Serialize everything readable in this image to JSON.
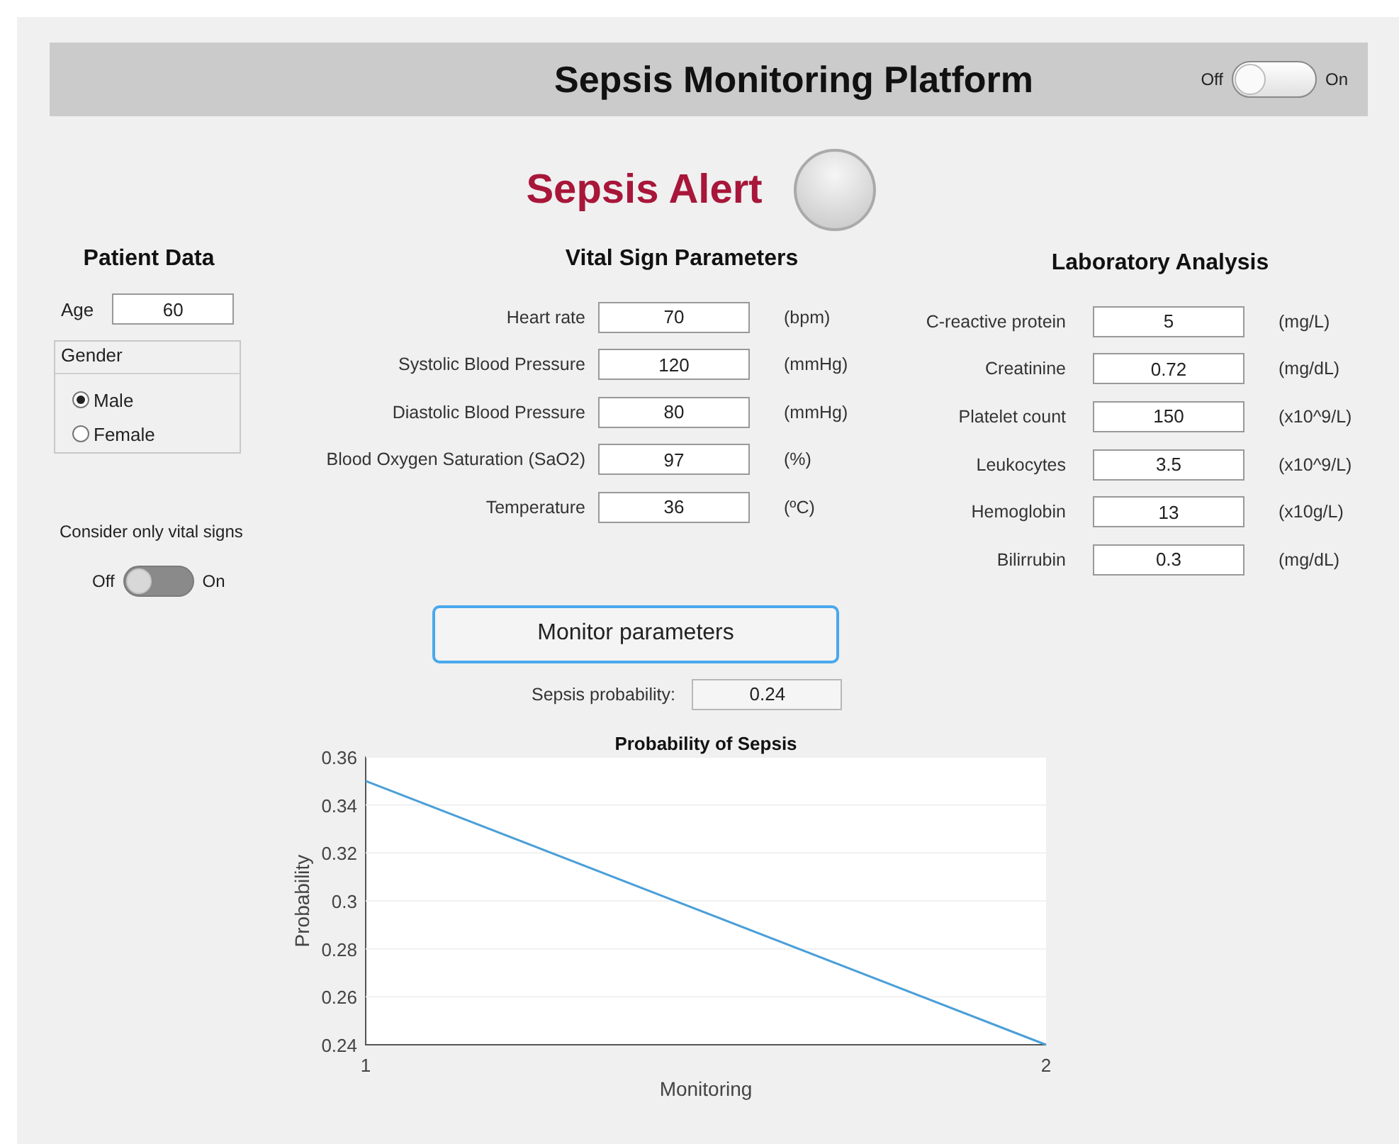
{
  "header": {
    "title": "Sepsis Monitoring Platform",
    "switch": {
      "off_label": "Off",
      "on_label": "On",
      "on": false
    }
  },
  "alert": {
    "label": "Sepsis Alert",
    "lit": false
  },
  "patient_data": {
    "title": "Patient Data",
    "age": {
      "label": "Age",
      "value": "60"
    },
    "gender": {
      "title": "Gender",
      "options": [
        {
          "label": "Male",
          "selected": true
        },
        {
          "label": "Female",
          "selected": false
        }
      ]
    },
    "vital_only": {
      "label": "Consider only vital signs",
      "off_label": "Off",
      "on_label": "On",
      "on": false
    }
  },
  "vital_signs": {
    "title": "Vital Sign Parameters",
    "rows": [
      {
        "label": "Heart rate",
        "value": "70",
        "unit": "(bpm)"
      },
      {
        "label": "Systolic Blood Pressure",
        "value": "120",
        "unit": "(mmHg)"
      },
      {
        "label": "Diastolic Blood Pressure",
        "value": "80",
        "unit": "(mmHg)"
      },
      {
        "label": "Blood Oxygen Saturation (SaO2)",
        "value": "97",
        "unit": "(%)"
      },
      {
        "label": "Temperature",
        "value": "36",
        "unit": "(ºC)"
      }
    ]
  },
  "laboratory": {
    "title": "Laboratory Analysis",
    "rows": [
      {
        "label": "C-reactive protein",
        "value": "5",
        "unit": "(mg/L)"
      },
      {
        "label": "Creatinine",
        "value": "0.72",
        "unit": "(mg/dL)"
      },
      {
        "label": "Platelet count",
        "value": "150",
        "unit": "(x10^9/L)"
      },
      {
        "label": "Leukocytes",
        "value": "3.5",
        "unit": "(x10^9/L)"
      },
      {
        "label": "Hemoglobin",
        "value": "13",
        "unit": "(x10g/L)"
      },
      {
        "label": "Bilirrubin",
        "value": "0.3",
        "unit": "(mg/dL)"
      }
    ]
  },
  "monitor_button": "Monitor parameters",
  "probability": {
    "label": "Sepsis probability:",
    "value": "0.24"
  },
  "chart": {
    "chart_data": {
      "type": "line",
      "title": "Probability of Sepsis",
      "xlabel": "Monitoring",
      "ylabel": "Probability",
      "x": [
        1,
        2
      ],
      "series": [
        {
          "color": "#4a9fd8",
          "values": [
            0.35,
            0.24
          ]
        }
      ],
      "grid": true,
      "xlim": [
        1,
        2
      ],
      "ylim": [
        0.24,
        0.36
      ],
      "xticks": [
        1,
        2
      ],
      "yticks": [
        0.24,
        0.26,
        0.28,
        0.3,
        0.32,
        0.34,
        0.36
      ]
    }
  }
}
